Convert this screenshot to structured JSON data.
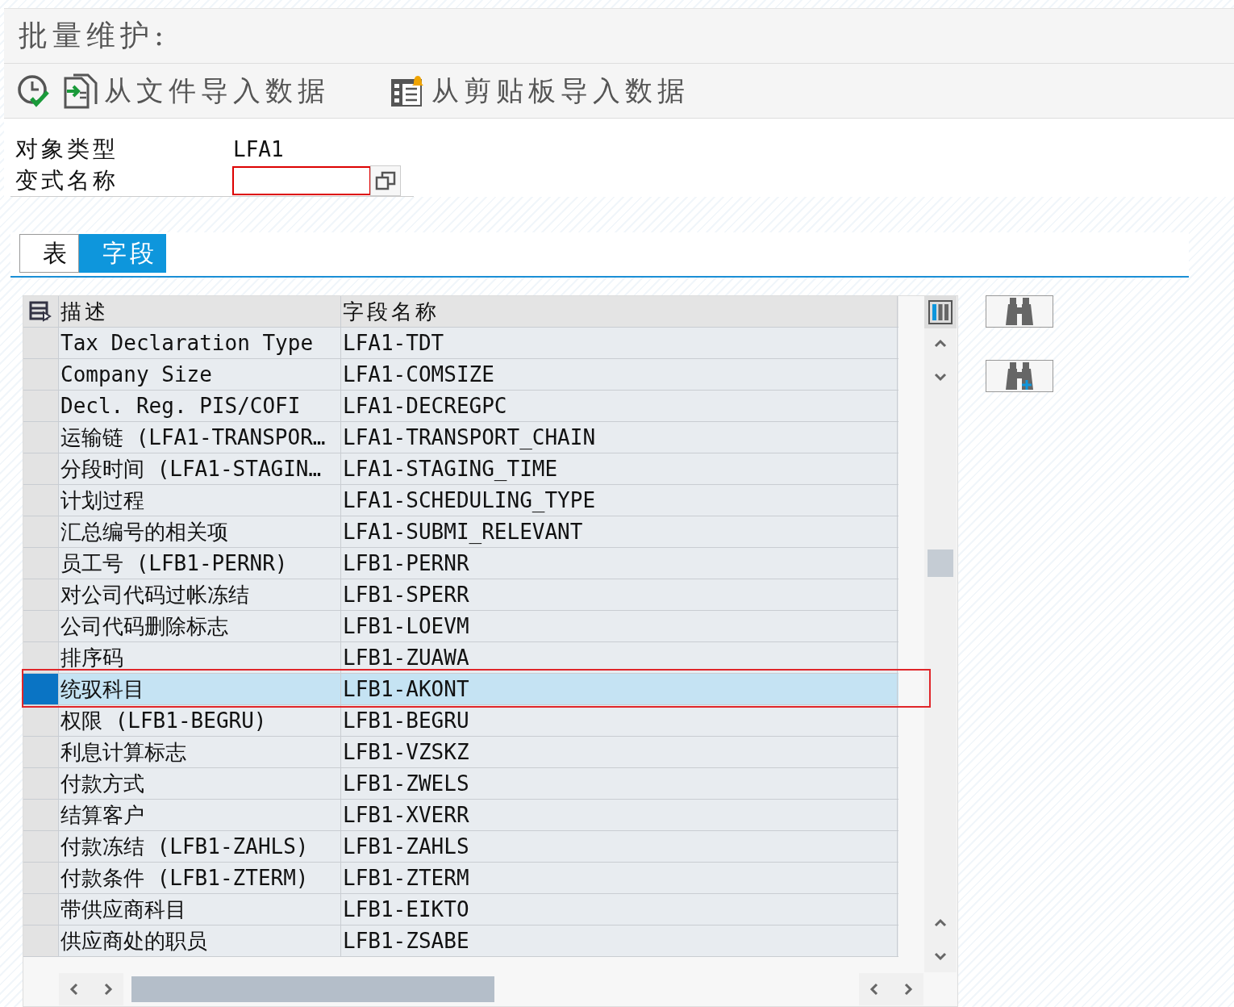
{
  "title": "批量维护:",
  "toolbar": {
    "buttons": [
      {
        "kind": "check"
      },
      {
        "kind": "file",
        "label": "从文件导入数据"
      },
      {
        "kind": "clipboard",
        "label": "从剪贴板导入数据"
      }
    ]
  },
  "fields": [
    {
      "label": "对象类型",
      "value": "LFA1",
      "kind": "text"
    },
    {
      "label": "变式名称",
      "kind": "input"
    }
  ],
  "tabs": [
    {
      "label": "表",
      "selected": false
    },
    {
      "label": "字段",
      "selected": true
    }
  ],
  "table": {
    "columns": [
      "描述",
      "字段名称"
    ],
    "rows": [
      {
        "cells": [
          "Tax Declaration Type",
          "LFA1-TDT"
        ],
        "selected": false
      },
      {
        "cells": [
          "Company Size",
          "LFA1-COMSIZE"
        ],
        "selected": false
      },
      {
        "cells": [
          "Decl. Reg. PIS/COFI",
          "LFA1-DECREGPC"
        ],
        "selected": false
      },
      {
        "cells": [
          "运输链 (LFA1-TRANSPOR…",
          "LFA1-TRANSPORT_CHAIN"
        ],
        "selected": false
      },
      {
        "cells": [
          "分段时间 (LFA1-STAGIN…",
          "LFA1-STAGING_TIME"
        ],
        "selected": false
      },
      {
        "cells": [
          "计划过程",
          "LFA1-SCHEDULING_TYPE"
        ],
        "selected": false
      },
      {
        "cells": [
          "汇总编号的相关项",
          "LFA1-SUBMI_RELEVANT"
        ],
        "selected": false
      },
      {
        "cells": [
          "员工号 (LFB1-PERNR)",
          "LFB1-PERNR"
        ],
        "selected": false
      },
      {
        "cells": [
          "对公司代码过帐冻结",
          "LFB1-SPERR"
        ],
        "selected": false
      },
      {
        "cells": [
          "公司代码删除标志",
          "LFB1-LOEVM"
        ],
        "selected": false
      },
      {
        "cells": [
          "排序码",
          "LFB1-ZUAWA"
        ],
        "selected": false
      },
      {
        "cells": [
          "统驭科目",
          "LFB1-AKONT"
        ],
        "selected": true
      },
      {
        "cells": [
          "权限 (LFB1-BEGRU)",
          "LFB1-BEGRU"
        ],
        "selected": false
      },
      {
        "cells": [
          "利息计算标志",
          "LFB1-VZSKZ"
        ],
        "selected": false
      },
      {
        "cells": [
          "付款方式",
          "LFB1-ZWELS"
        ],
        "selected": false
      },
      {
        "cells": [
          "结算客户",
          "LFB1-XVERR"
        ],
        "selected": false
      },
      {
        "cells": [
          "付款冻结 (LFB1-ZAHLS)",
          "LFB1-ZAHLS"
        ],
        "selected": false
      },
      {
        "cells": [
          "付款条件 (LFB1-ZTERM)",
          "LFB1-ZTERM"
        ],
        "selected": false
      },
      {
        "cells": [
          "带供应商科目",
          "LFB1-EIKTO"
        ],
        "selected": false
      },
      {
        "cells": [
          "供应商处的职员",
          "LFB1-ZSABE"
        ],
        "selected": false
      }
    ]
  }
}
